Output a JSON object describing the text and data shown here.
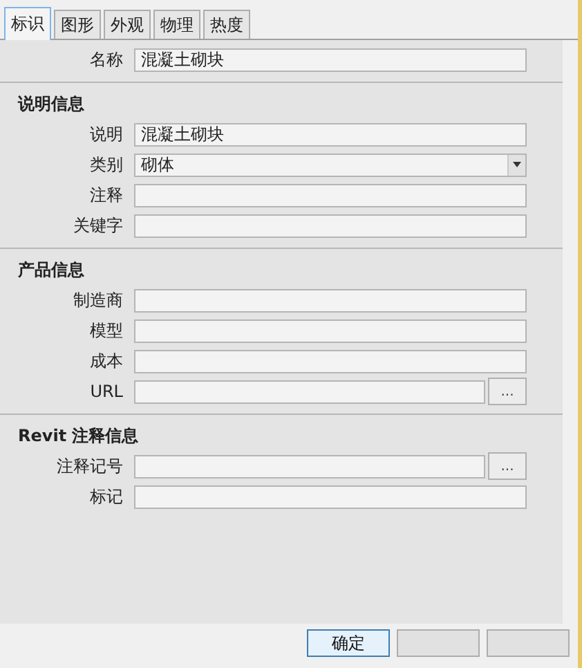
{
  "tabs": [
    {
      "label": "标识",
      "selected": true
    },
    {
      "label": "图形",
      "selected": false
    },
    {
      "label": "外观",
      "selected": false
    },
    {
      "label": "物理",
      "selected": false
    },
    {
      "label": "热度",
      "selected": false
    }
  ],
  "sections": [
    {
      "fields": [
        {
          "label": "名称",
          "kind": "text",
          "value": "混凝土砌块"
        }
      ]
    },
    {
      "heading": "说明信息",
      "fields": [
        {
          "label": "说明",
          "kind": "text",
          "value": "混凝土砌块"
        },
        {
          "label": "类别",
          "kind": "dropdown",
          "value": "砌体"
        },
        {
          "label": "注释",
          "kind": "text"
        },
        {
          "label": "关键字",
          "kind": "text"
        }
      ]
    },
    {
      "heading": "产品信息",
      "fields": [
        {
          "label": "制造商",
          "kind": "text"
        },
        {
          "label": "模型",
          "kind": "text"
        },
        {
          "label": "成本",
          "kind": "text"
        },
        {
          "label": "URL",
          "kind": "browse",
          "button": "..."
        }
      ]
    },
    {
      "heading": "Revit 注释信息",
      "fields": [
        {
          "label": "注释记号",
          "kind": "browse",
          "button": "..."
        },
        {
          "label": "标记",
          "kind": "text"
        }
      ]
    }
  ],
  "buttons": [
    {
      "kind": "labeled",
      "label": "确定",
      "selected": true
    },
    {
      "kind": "blank",
      "selected": false
    },
    {
      "kind": "blank",
      "selected": false
    }
  ]
}
